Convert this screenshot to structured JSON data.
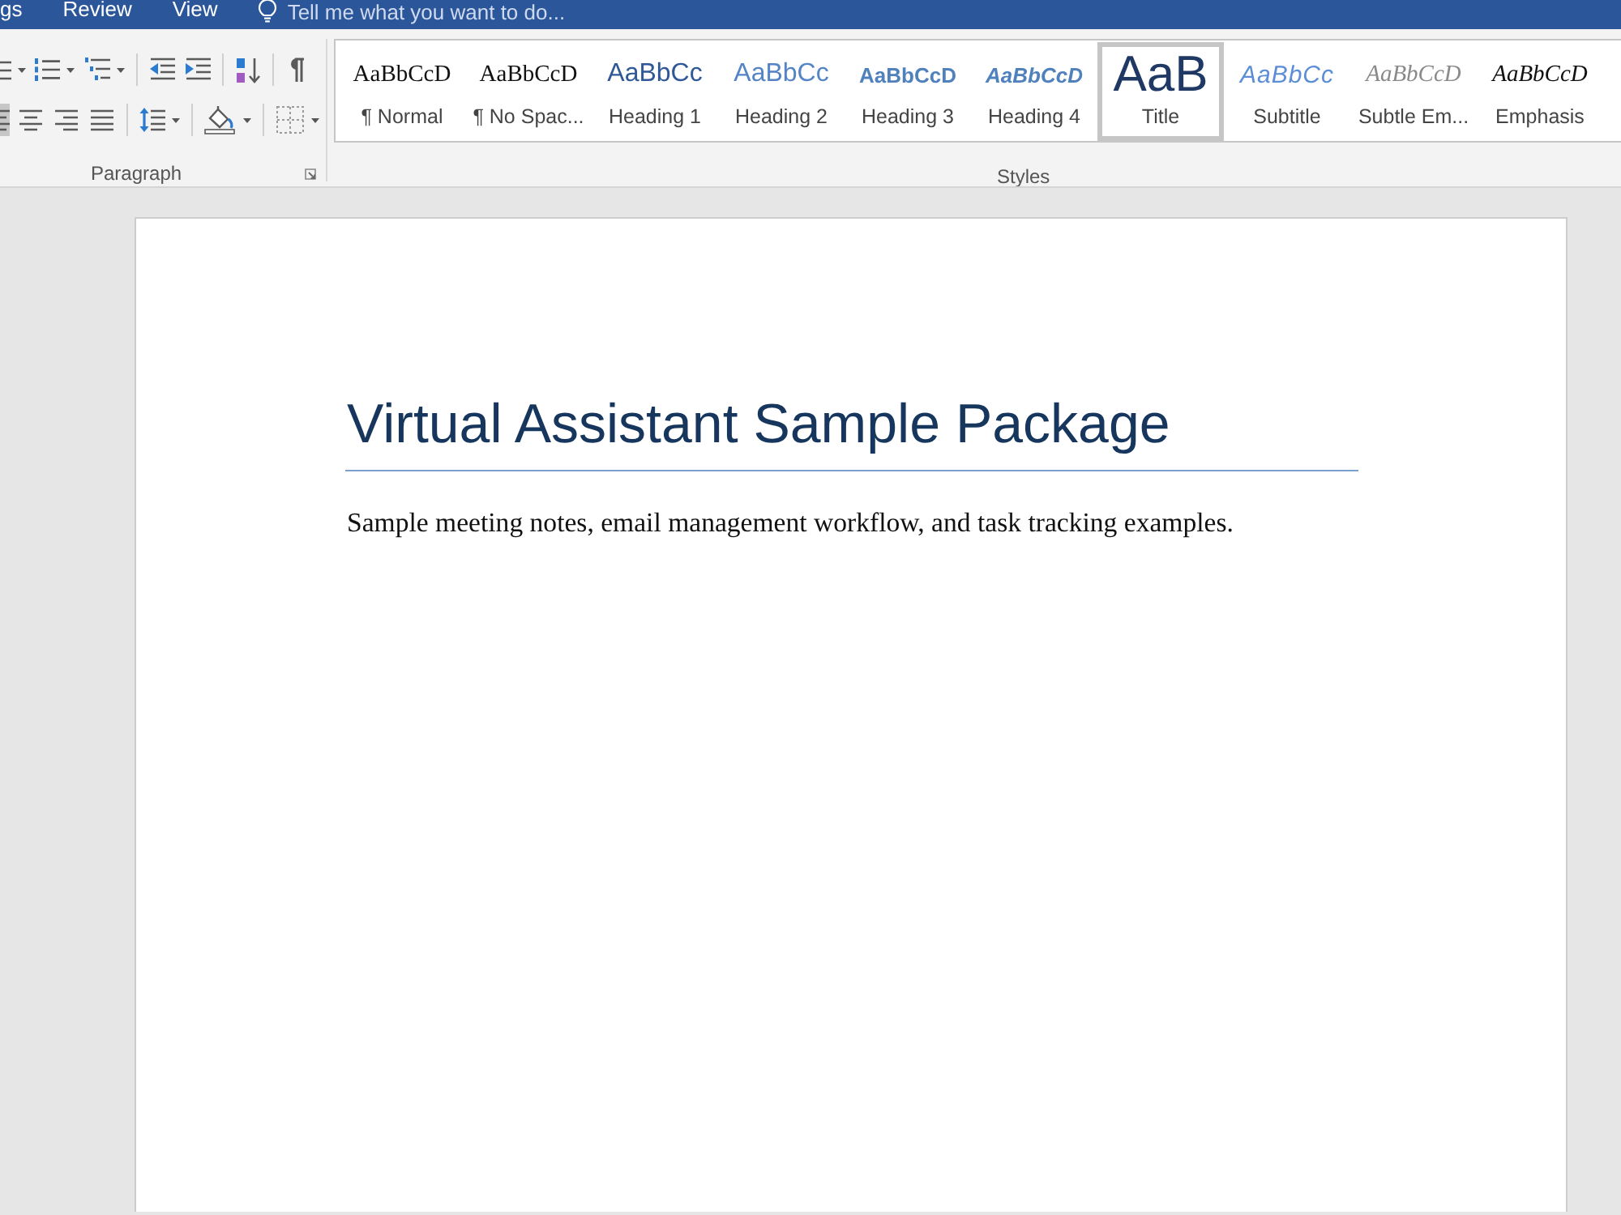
{
  "title_bar": {
    "tabs": [
      {
        "label": "gs",
        "selected": false
      },
      {
        "label": "Review",
        "selected": false
      },
      {
        "label": "View",
        "selected": false
      }
    ],
    "tell_me": {
      "placeholder": "Tell me what you want to do..."
    }
  },
  "ribbon": {
    "paragraph": {
      "label": "Paragraph",
      "row_1": [
        {
          "tools": [
            {
              "kind": "bullets"
            },
            {
              "kind": "numbering"
            },
            {
              "kind": "multilevel"
            }
          ]
        },
        {
          "tools": [
            {
              "kind": "outdent"
            },
            {
              "kind": "indent"
            }
          ]
        },
        {
          "tools": [
            {
              "kind": "sort"
            }
          ]
        },
        {
          "tools": [
            {
              "kind": "pilcrow"
            }
          ]
        }
      ],
      "row_2": [
        {
          "tools": [
            {
              "kind": "left",
              "selected": true
            },
            {
              "kind": "center",
              "selected": false
            },
            {
              "kind": "right",
              "selected": false
            },
            {
              "kind": "justify",
              "selected": false
            }
          ]
        },
        {
          "tools": [
            {
              "kind": "spacing"
            }
          ]
        },
        {
          "tools": [
            {
              "kind": "shading"
            }
          ]
        },
        {
          "tools": [
            {
              "kind": "borders"
            }
          ]
        }
      ]
    },
    "styles": {
      "label": "Styles",
      "items": [
        {
          "kind": "normal",
          "sample": "AaBbCcD",
          "label": "¶ Normal",
          "selected": false
        },
        {
          "kind": "nospacing",
          "sample": "AaBbCcD",
          "label": "¶ No Spac...",
          "selected": false
        },
        {
          "kind": "heading1",
          "sample": "AaBbCc",
          "label": "Heading 1",
          "selected": false
        },
        {
          "kind": "heading2",
          "sample": "AaBbCc",
          "label": "Heading 2",
          "selected": false
        },
        {
          "kind": "heading3",
          "sample": "AaBbCcD",
          "label": "Heading 3",
          "selected": false
        },
        {
          "kind": "heading4",
          "sample": "AaBbCcD",
          "label": "Heading 4",
          "selected": false
        },
        {
          "kind": "title",
          "sample": "AaB",
          "label": "Title",
          "selected": true
        },
        {
          "kind": "subtitle",
          "sample": "AaBbCc",
          "label": "Subtitle",
          "selected": false
        },
        {
          "kind": "subtleemphasis",
          "sample": "AaBbCcD",
          "label": "Subtle Em...",
          "selected": false
        },
        {
          "kind": "emphasis",
          "sample": "AaBbCcD",
          "label": "Emphasis",
          "selected": false
        }
      ]
    }
  },
  "document": {
    "title": "Virtual Assistant Sample Package",
    "body": "Sample meeting notes, email management workflow, and task tracking examples."
  }
}
